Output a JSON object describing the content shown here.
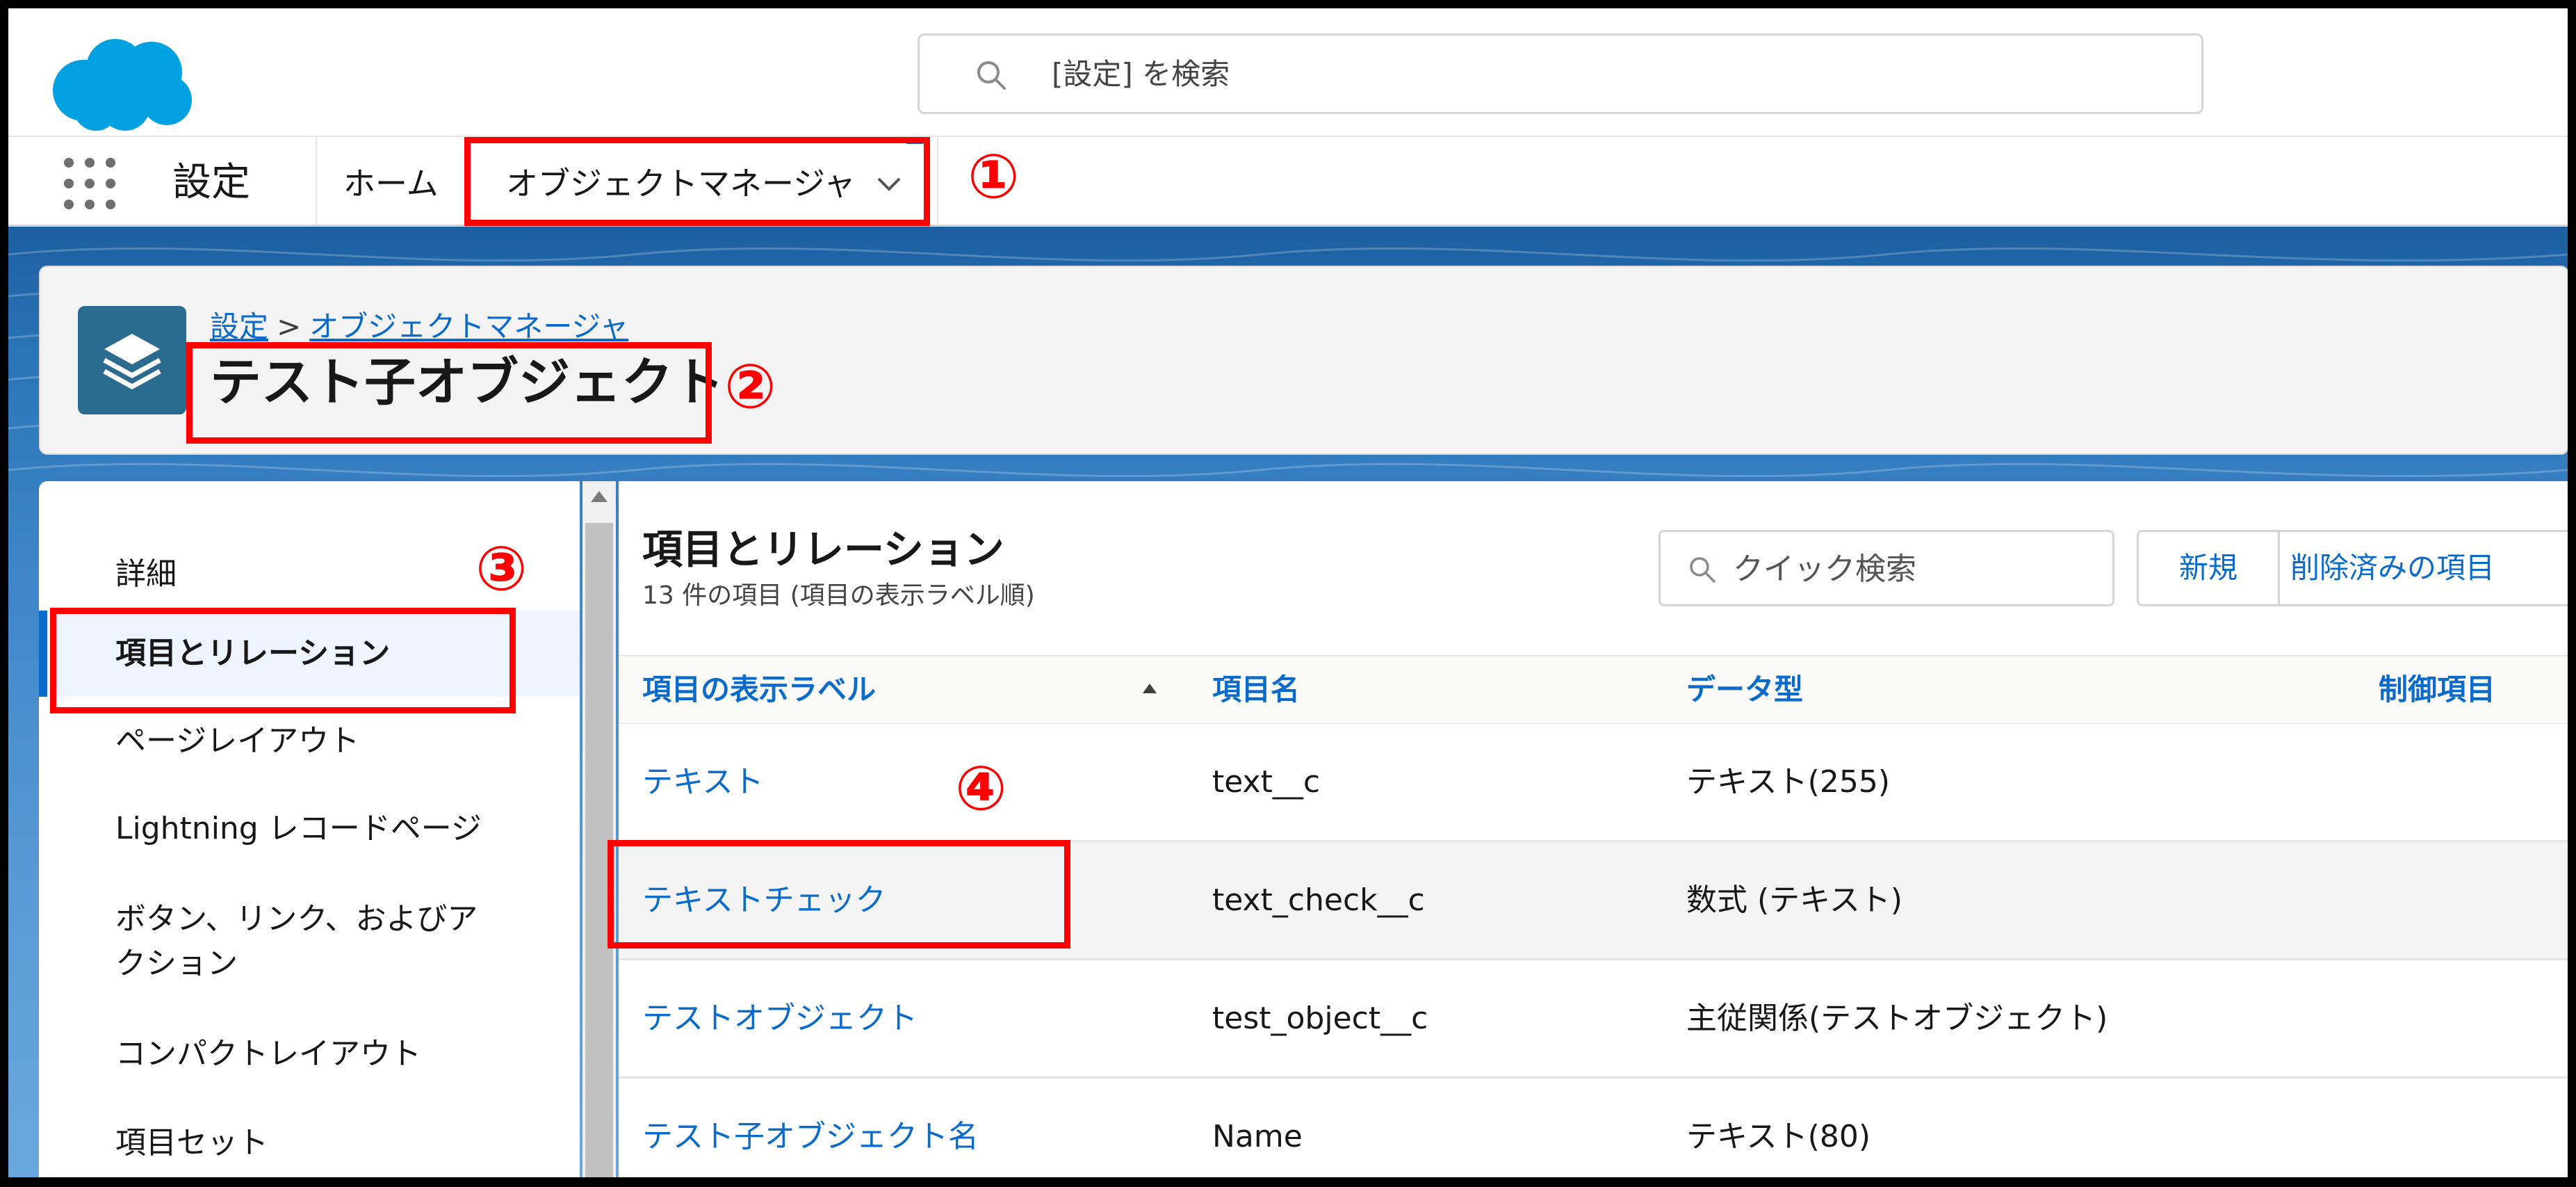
{
  "header": {
    "search_placeholder": "[設定] を検索"
  },
  "nav": {
    "app_name": "設定",
    "tabs": [
      {
        "label": "ホーム"
      },
      {
        "label": "オブジェクトマネージャ"
      }
    ]
  },
  "breadcrumb": {
    "root": "設定",
    "separator": ">",
    "current": "オブジェクトマネージャ"
  },
  "object": {
    "title": "テスト子オブジェクト"
  },
  "sidebar": {
    "items": [
      {
        "label": "詳細"
      },
      {
        "label": "項目とリレーション"
      },
      {
        "label": "ページレイアウト"
      },
      {
        "label": "Lightning レコードページ"
      },
      {
        "label": "ボタン、リンク、およびア"
      },
      {
        "label": "クション"
      },
      {
        "label": "コンパクトレイアウト"
      },
      {
        "label": "項目セット"
      }
    ]
  },
  "section": {
    "title": "項目とリレーション",
    "subtitle": "13 件の項目 (項目の表示ラベル順)",
    "quick_search_placeholder": "クイック検索",
    "new_button": "新規",
    "deleted_button": "削除済みの項目"
  },
  "table": {
    "columns": [
      "項目の表示ラベル",
      "項目名",
      "データ型",
      "制御項目"
    ],
    "rows": [
      {
        "label": "テキスト",
        "name": "text__c",
        "type": "テキスト(255)"
      },
      {
        "label": "テキストチェック",
        "name": "text_check__c",
        "type": "数式 (テキスト)"
      },
      {
        "label": "テストオブジェクト",
        "name": "test_object__c",
        "type": "主従関係(テストオブジェクト)"
      },
      {
        "label": "テスト子オブジェクト名",
        "name": "Name",
        "type": "テキスト(80)"
      }
    ]
  },
  "annotations": {
    "m1": "①",
    "m2": "②",
    "m3": "③",
    "m4": "④"
  },
  "colors": {
    "accent": "#0b6bcb",
    "annotation": "#ff0000",
    "brand": "#00a1e0",
    "object_icon": "#2a6b8f"
  }
}
